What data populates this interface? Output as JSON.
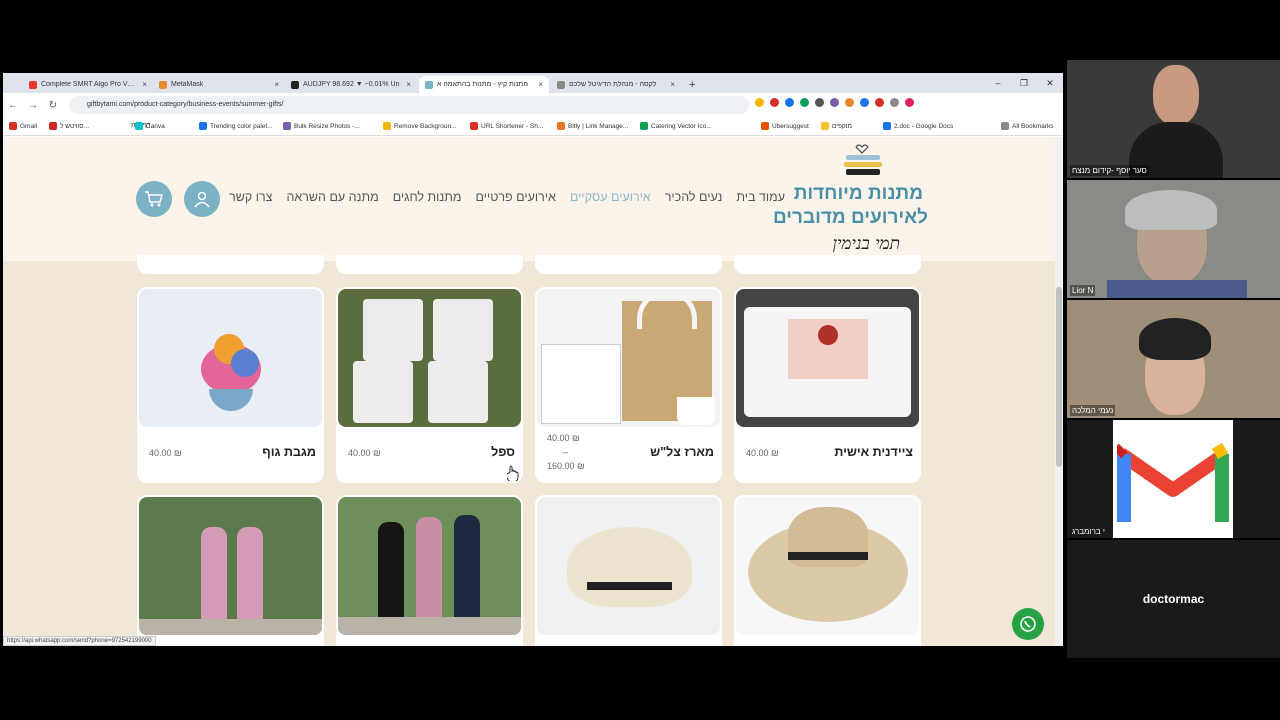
{
  "browser": {
    "tabs": [
      {
        "title": "Complete SMRT Algo Pro V2 G",
        "color": "#e33"
      },
      {
        "title": "MetaMask",
        "color": "#e88a2e"
      },
      {
        "title": "AUDJPY 98.692 ▼ −0.01% Un",
        "color": "#222"
      },
      {
        "title": "מתנות קיץ - מתנות בהתאמה א",
        "color": "#7bb2c6"
      },
      {
        "title": "לקסה - מנהלת הדיגיטל שלכם",
        "color": "#888"
      }
    ],
    "url": "giftbytami.com/product-category/business-events/summer-gifts/",
    "bookmarks": [
      "Gmail",
      "סוויטש ל...",
      "דף בית",
      "Canva",
      "Trending color palet...",
      "Bulk Resize Photos -...",
      "Remove Backgroun...",
      "URL Shortener - Sh...",
      "Bitly | Link Manage...",
      "Catering Vector Ico...",
      "Ubersuggest",
      "מוקפים",
      "2.doc - Google Docs",
      "All Bookmarks"
    ],
    "status_url": "https://api.whatsapp.com/send?phone=972542199000"
  },
  "site": {
    "logo": {
      "line1": "מתנות מיוחדות",
      "line2": "לאירועים מדוברים",
      "line3": "תמי בנימין"
    },
    "menu": [
      "עמוד בית",
      "נעים להכיר",
      "אירועים עסקיים",
      "אירועים פרטיים",
      "מתנות לחגים",
      "מתנה עם השראה",
      "צרו קשר"
    ],
    "active_menu": "אירועים עסקיים",
    "accent": "#7bb2c6"
  },
  "products": [
    {
      "name": "ציידנית אישית",
      "price": "40.00 ₪"
    },
    {
      "name": "מארז צל\"ש",
      "price": "40.00 ₪",
      "price_sep": "–",
      "price_max": "160.00 ₪"
    },
    {
      "name": "ספל",
      "price": "40.00 ₪"
    },
    {
      "name": "מגבת גוף",
      "price": "40.00 ₪"
    }
  ],
  "product_images": [
    "cooler-bag",
    "tote-gift-set",
    "mugs",
    "towel-flowers"
  ],
  "row2_images": [
    "hat-naomi",
    "hat-name",
    "bottles-dark",
    "bottles-pink"
  ],
  "participants": [
    {
      "name": "סער יוסף -קידום מנצח"
    },
    {
      "name": "Lior N"
    },
    {
      "name": "נעמי המלכה"
    },
    {
      "name": "י ברומברג"
    },
    {
      "name": "doctormac"
    }
  ]
}
